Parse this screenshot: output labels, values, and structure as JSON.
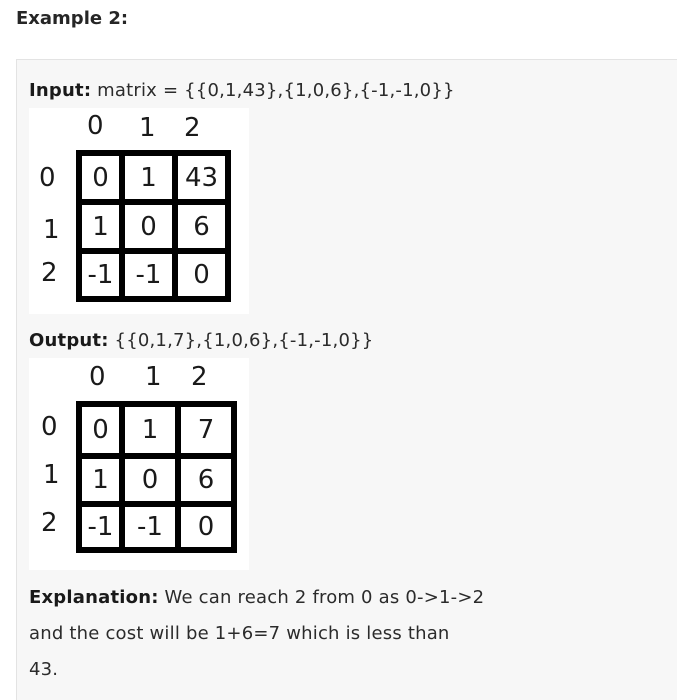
{
  "heading": "Example 2:",
  "input": {
    "label": "Input:",
    "text": " matrix = {{0,1,43},{1,0,6},{-1,-1,0}}"
  },
  "input_matrix": {
    "col_headers": [
      "0",
      "1",
      "2"
    ],
    "row_headers": [
      "0",
      "1",
      "2"
    ],
    "cells": [
      [
        "0",
        "1",
        "43"
      ],
      [
        "1",
        "0",
        "6"
      ],
      [
        "-1",
        "-1",
        "0"
      ]
    ]
  },
  "output": {
    "label": "Output:",
    "text": " {{0,1,7},{1,0,6},{-1,-1,0}}"
  },
  "output_matrix": {
    "col_headers": [
      "0",
      "1",
      "2"
    ],
    "row_headers": [
      "0",
      "1",
      "2"
    ],
    "cells": [
      [
        "0",
        "1",
        "7"
      ],
      [
        "1",
        "0",
        "6"
      ],
      [
        "-1",
        "-1",
        "0"
      ]
    ]
  },
  "explanation": {
    "label": "Explanation:",
    "line1": " We can reach 2 from 0 as 0->1->2",
    "line2": "and the cost will be 1+6=7 which is less than",
    "line3": "43."
  }
}
